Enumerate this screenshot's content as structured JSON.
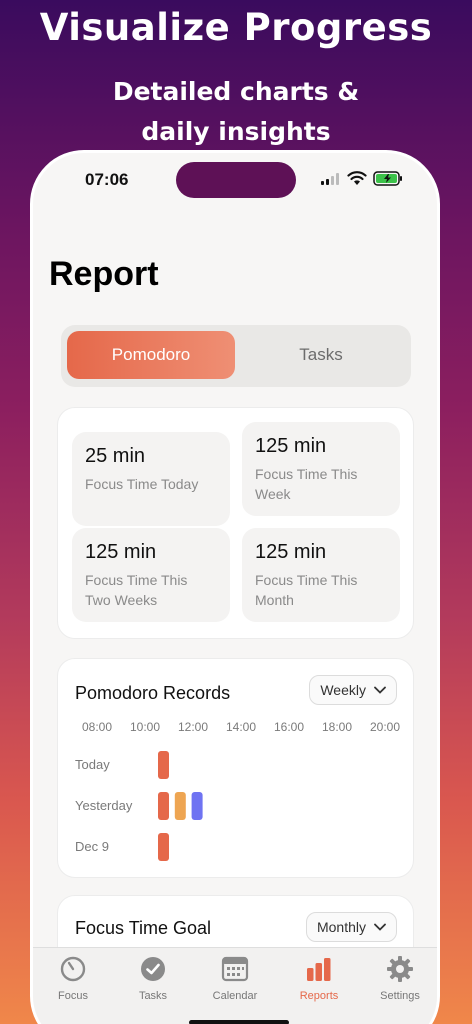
{
  "promo": {
    "title": "Visualize Progress",
    "subtitle_line1": "Detailed charts &",
    "subtitle_line2": "daily insights"
  },
  "status_bar": {
    "time": "07:06"
  },
  "page_title": "Report",
  "segment": {
    "options": [
      "Pomodoro",
      "Tasks"
    ],
    "selected": "Pomodoro"
  },
  "stats": [
    {
      "value": "25 min",
      "label_line1": "Focus Time Today",
      "label_line2": ""
    },
    {
      "value": "125 min",
      "label_line1": "Focus Time This",
      "label_line2": "Week"
    },
    {
      "value": "125 min",
      "label_line1": "Focus Time This",
      "label_line2": "Two Weeks"
    },
    {
      "value": "125 min",
      "label_line1": "Focus Time This",
      "label_line2": "Month"
    }
  ],
  "records": {
    "title": "Pomodoro Records",
    "period": "Weekly",
    "chart_data": {
      "type": "bar",
      "x_ticks": [
        "08:00",
        "10:00",
        "12:00",
        "14:00",
        "16:00",
        "18:00",
        "20:00"
      ],
      "rows": [
        {
          "label": "Today",
          "sessions": [
            {
              "start_hour": 10.5,
              "color": "#e5684a"
            }
          ]
        },
        {
          "label": "Yesterday",
          "sessions": [
            {
              "start_hour": 10.5,
              "color": "#e5684a"
            },
            {
              "start_hour": 11.2,
              "color": "#eea552"
            },
            {
              "start_hour": 11.9,
              "color": "#6f73f2"
            }
          ]
        },
        {
          "label": "Dec 9",
          "sessions": [
            {
              "start_hour": 10.5,
              "color": "#e5684a"
            }
          ]
        }
      ],
      "session_length_hours": 0.42
    }
  },
  "goal": {
    "title": "Focus Time Goal",
    "period": "Monthly"
  },
  "tabs": [
    {
      "label": "Focus",
      "icon": "timer-icon",
      "active": false
    },
    {
      "label": "Tasks",
      "icon": "checkmark-circle-icon",
      "active": false
    },
    {
      "label": "Calendar",
      "icon": "calendar-icon",
      "active": false
    },
    {
      "label": "Reports",
      "icon": "bar-chart-icon",
      "active": true
    },
    {
      "label": "Settings",
      "icon": "gear-icon",
      "active": false
    }
  ],
  "colors": {
    "accent": "#e5684a",
    "inactive": "#777777"
  }
}
